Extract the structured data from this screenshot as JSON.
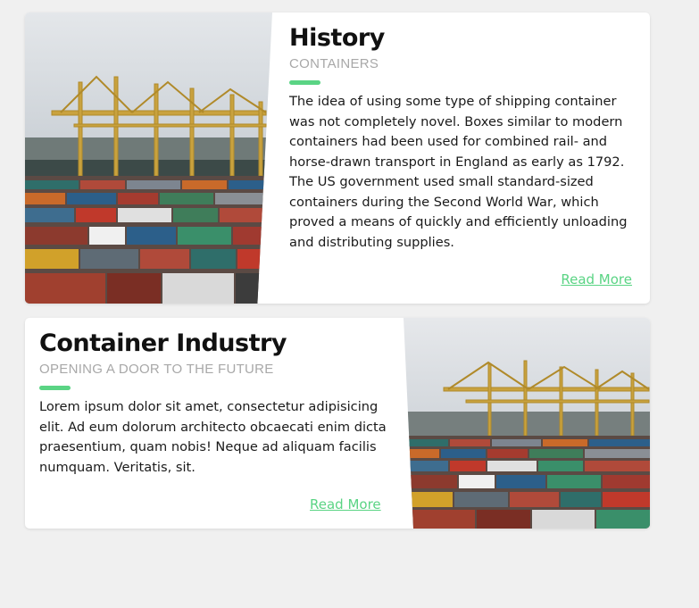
{
  "cards": [
    {
      "title": "History",
      "subtitle": "CONTAINERS",
      "body": "The idea of using some type of shipping container was not completely novel. Boxes similar to modern containers had been used for combined rail- and horse-drawn transport in England as early as 1792. The US government used small standard-sized containers during the Second World War, which proved a means of quickly and efficiently unloading and distributing supplies.",
      "link": "Read More",
      "image": "port-container-terminal-photo"
    },
    {
      "title": "Container Industry",
      "subtitle": "OPENING A DOOR TO THE FUTURE",
      "body": "Lorem ipsum dolor sit amet, consectetur adipisicing elit. Ad eum dolorum architecto obcaecati enim dicta praesentium, quam nobis! Neque ad aliquam facilis numquam. Veritatis, sit.",
      "link": "Read More",
      "image": "port-container-terminal-photo"
    }
  ],
  "colors": {
    "accent": "#5ad484",
    "background": "#f0f0f0",
    "card": "#ffffff",
    "subtitle": "#a8a8a8",
    "text": "#1a1a1a"
  }
}
